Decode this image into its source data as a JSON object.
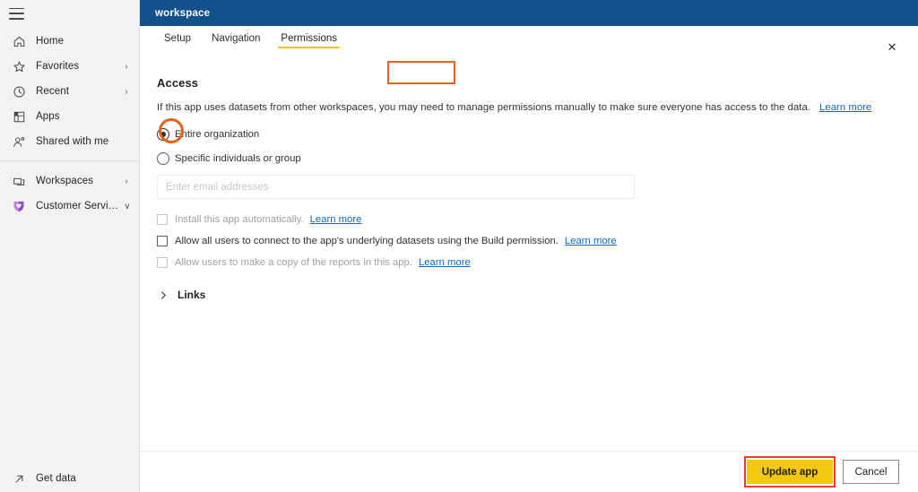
{
  "sidebar": {
    "menu_icon": "hamburger-icon",
    "items": [
      {
        "label": "Home",
        "icon": "home-icon",
        "chevron": ""
      },
      {
        "label": "Favorites",
        "icon": "star-icon",
        "chevron": "›"
      },
      {
        "label": "Recent",
        "icon": "clock-icon",
        "chevron": "›"
      },
      {
        "label": "Apps",
        "icon": "apps-grid-icon",
        "chevron": ""
      },
      {
        "label": "Shared with me",
        "icon": "shared-people-icon",
        "chevron": ""
      }
    ],
    "group2": [
      {
        "label": "Workspaces",
        "icon": "workspaces-icon",
        "chevron": "›"
      },
      {
        "label": "Customer Service A...",
        "icon": "shield-heart-icon",
        "chevron": "∨"
      }
    ],
    "footer": {
      "label": "Get data",
      "icon": "arrow-up-right-icon"
    }
  },
  "header": {
    "title": "workspace",
    "close_label": "✕",
    "bar_color": "#11508a"
  },
  "tabs": [
    {
      "label": "Setup",
      "active": false
    },
    {
      "label": "Navigation",
      "active": false
    },
    {
      "label": "Permissions",
      "active": true
    }
  ],
  "access": {
    "title": "Access",
    "description": "If this app uses datasets from other workspaces, you may need to manage permissions manually to make sure everyone has access to the data.",
    "description_link": "Learn more",
    "radios": [
      {
        "label": "Entire organization",
        "checked": true
      },
      {
        "label": "Specific individuals or group",
        "checked": false
      }
    ],
    "email_placeholder": "Enter email addresses",
    "email_value": "",
    "checkboxes": [
      {
        "label": "Install this app automatically.",
        "checked": false,
        "disabled": true,
        "link": "Learn more"
      },
      {
        "label": "Allow all users to connect to the app's underlying datasets using the Build permission.",
        "checked": false,
        "disabled": false,
        "link": "Learn more"
      },
      {
        "label": "Allow users to make a copy of the reports in this app.",
        "checked": false,
        "disabled": true,
        "link": "Learn more"
      }
    ]
  },
  "links_section": {
    "label": "Links",
    "expanded": false,
    "chevron": "›"
  },
  "footer": {
    "primary_label": "Update app",
    "secondary_label": "Cancel"
  },
  "annotations": {
    "tab_highlight_color": "#e8611c",
    "radio_highlight_color": "#e8611c",
    "button_highlight_color": "#ee3b33",
    "accent_yellow": "#f2c811",
    "link_blue": "#0d6abf"
  }
}
